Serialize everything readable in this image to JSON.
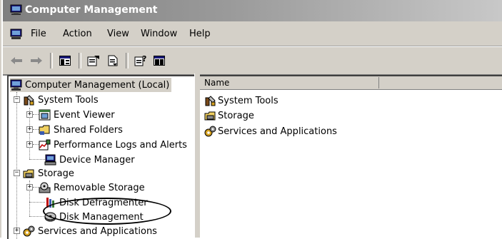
{
  "window": {
    "title": "Computer Management"
  },
  "menu": {
    "items": [
      "File",
      "Action",
      "View",
      "Window",
      "Help"
    ]
  },
  "toolbar": {
    "buttons": [
      "back-arrow-icon",
      "forward-arrow-icon",
      "show-hide-tree-icon",
      "properties-icon",
      "export-list-icon",
      "help-icon",
      "show-hide-action-pane-icon"
    ]
  },
  "tree": {
    "root": "Computer Management (Local)",
    "system_tools": "System Tools",
    "event_viewer": "Event Viewer",
    "shared_folders": "Shared Folders",
    "performance_logs": "Performance Logs and Alerts",
    "device_manager": "Device Manager",
    "storage": "Storage",
    "removable_storage": "Removable Storage",
    "disk_defragmenter": "Disk Defragmenter",
    "disk_management": "Disk Management",
    "services_applications": "Services and Applications",
    "expander_plus": "+",
    "expander_minus": "−"
  },
  "list": {
    "column_name": "Name",
    "items": [
      "System Tools",
      "Storage",
      "Services and Applications"
    ]
  },
  "colors": {
    "titlebar": "#8c8c8c",
    "chrome": "#d4d0c8",
    "highlight_oval": "#000000"
  }
}
